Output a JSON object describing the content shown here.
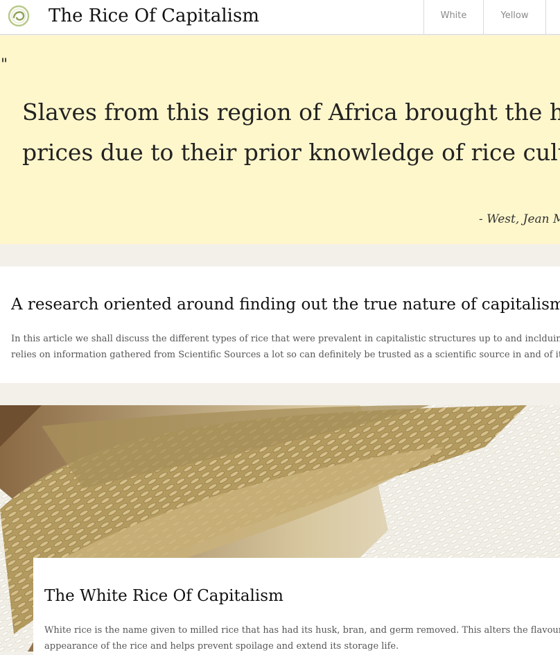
{
  "header": {
    "title": "The Rice Of Capitalism",
    "logo_icon": "swirl-logo-icon",
    "nav": [
      "White",
      "Yellow"
    ]
  },
  "quote": {
    "mark": "\"",
    "lines": [
      "Slaves from this region of Africa brought the high",
      "prices due to their prior knowledge of rice cultur"
    ],
    "attribution": "- West, Jean M."
  },
  "intro": {
    "heading": "A research oriented around finding out the true nature of capitalism",
    "lines": [
      "In this article we shall discuss the different types of rice that were prevalent in capitalistic structures up to and inclduing t",
      "relies on information gathered from Scientific Sources a lot so can definitely be trusted as a scientific source in and of itse"
    ]
  },
  "white_rice": {
    "heading": "The White Rice Of Capitalism",
    "lines": [
      "White rice is the name given to milled rice that has had its husk, bran, and germ removed. This alters the flavour, te",
      "appearance of the rice and helps prevent spoilage and extend its storage life."
    ]
  },
  "colors": {
    "quote_bg": "#fff7cc",
    "page_bg": "#f3f0ea",
    "card_bg": "#ffffff"
  }
}
